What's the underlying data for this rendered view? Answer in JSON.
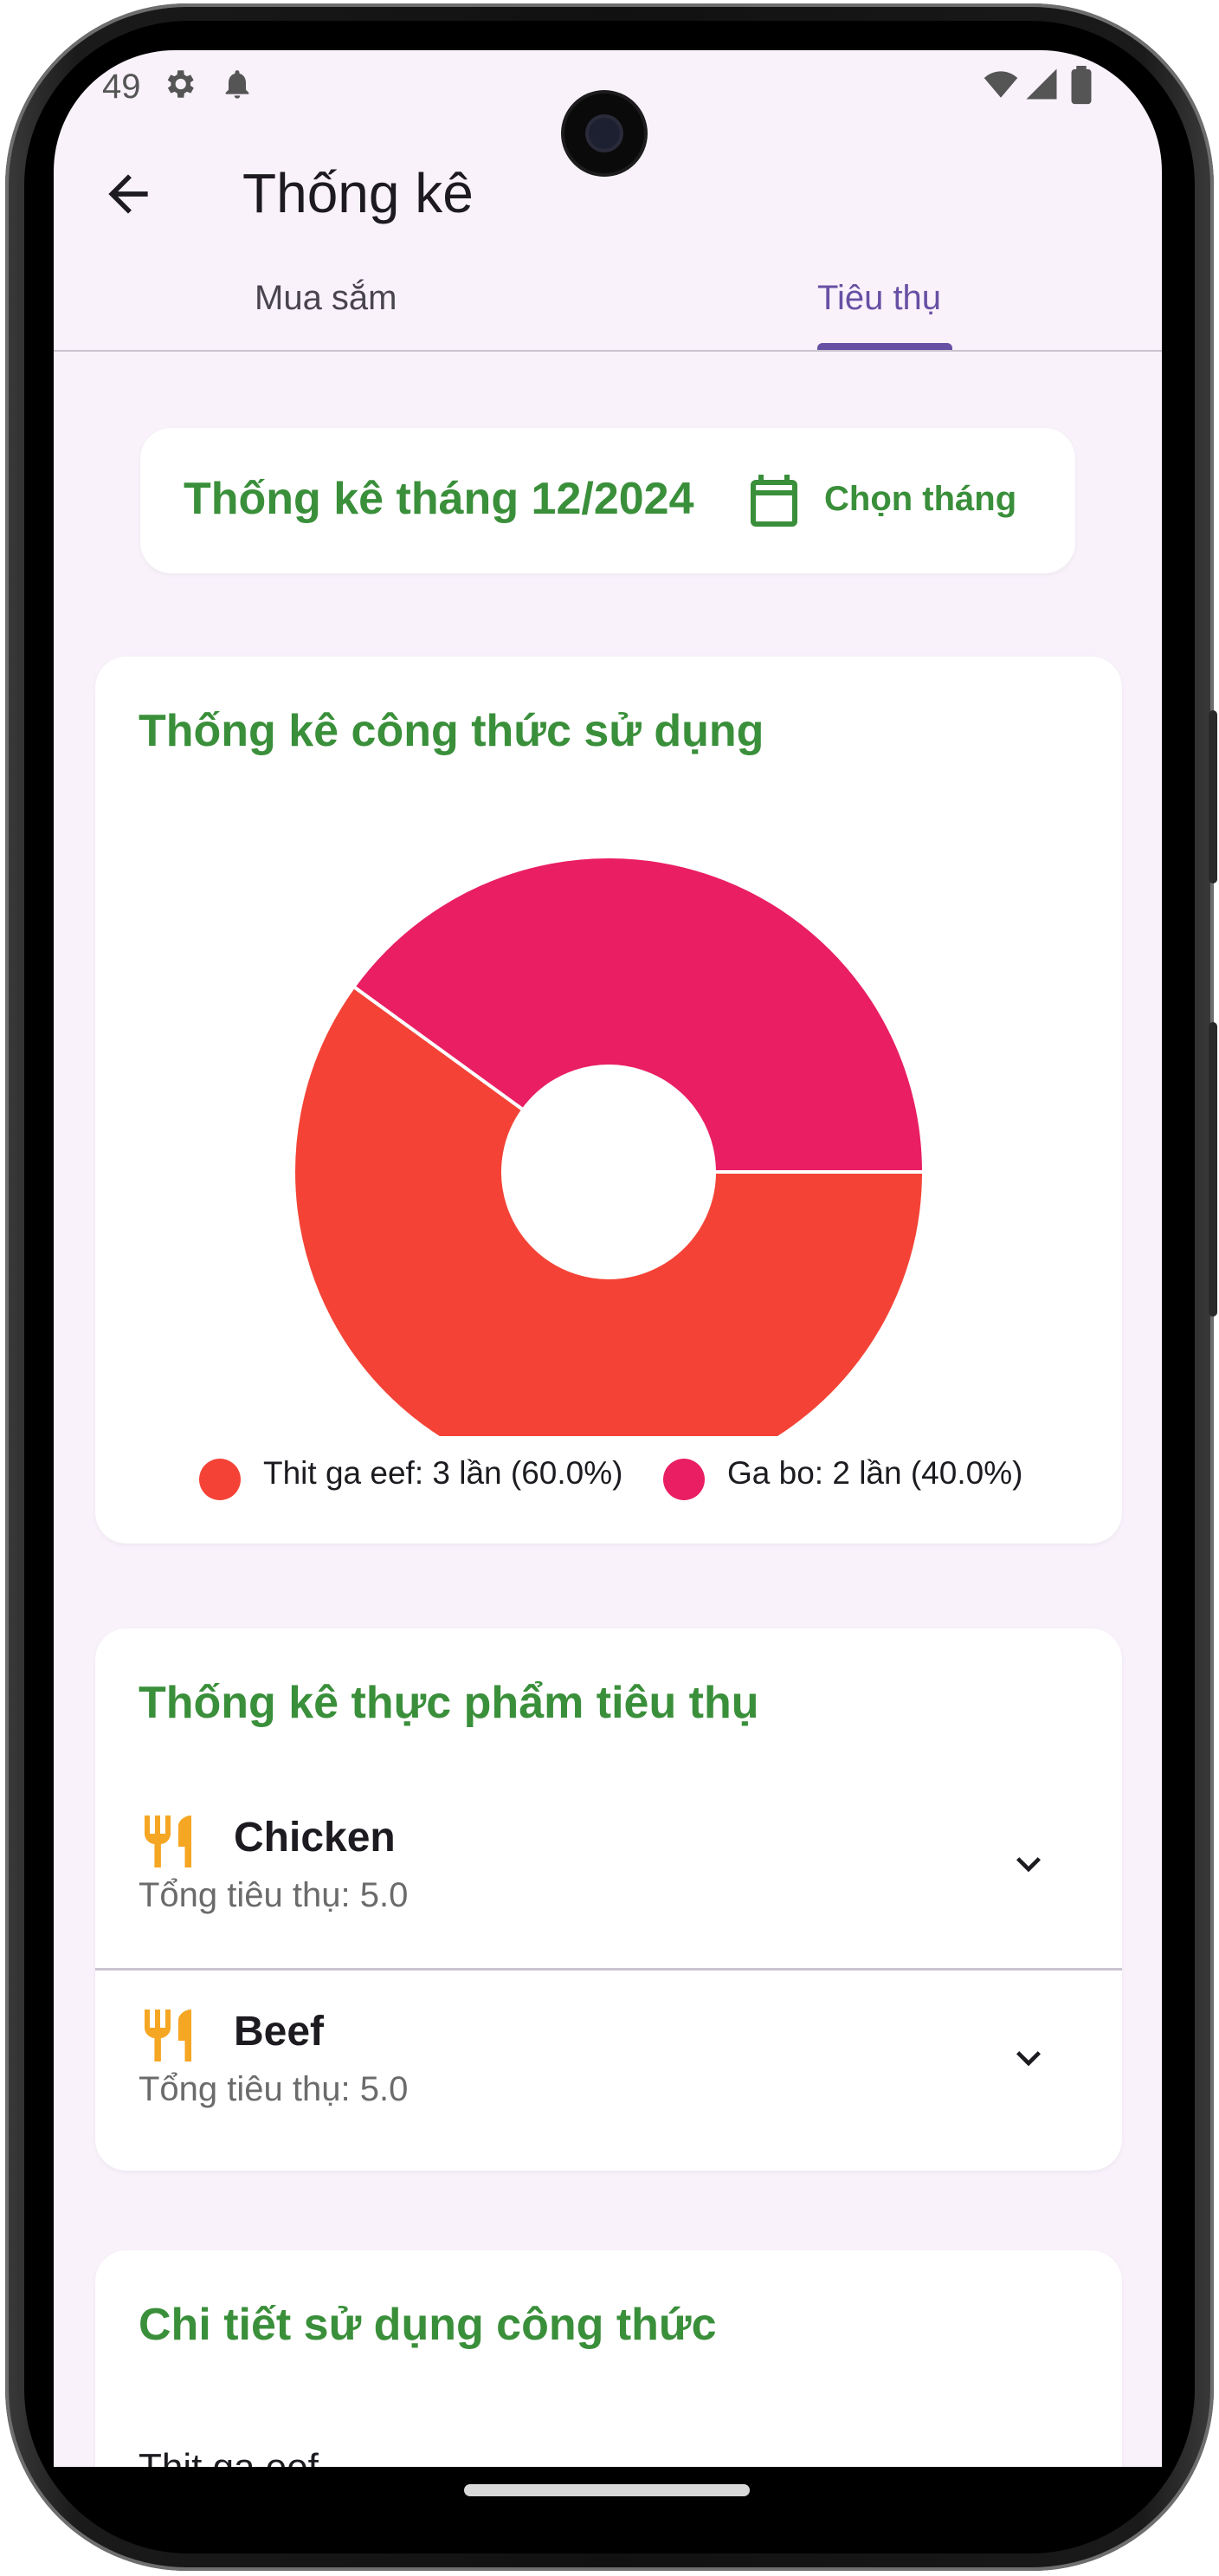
{
  "status_bar": {
    "time": "49"
  },
  "app_bar": {
    "title": "Thống kê"
  },
  "tabs": [
    {
      "label": "Mua sắm",
      "active": false
    },
    {
      "label": "Tiêu thụ",
      "active": true
    }
  ],
  "month_card": {
    "title": "Thống kê tháng 12/2024",
    "button_label": "Chọn tháng"
  },
  "recipe_chart_card": {
    "title": "Thống kê công thức sử dụng"
  },
  "chart_data": {
    "type": "pie",
    "donut": true,
    "categories": [
      "Thit ga eef",
      "Ga bo"
    ],
    "values": [
      3,
      2
    ],
    "percentages": [
      60.0,
      40.0
    ],
    "colors": [
      "#f44336",
      "#e91e63"
    ],
    "legend": [
      "Thit ga eef: 3 lần (60.0%)",
      "Ga bo: 2 lần (40.0%)"
    ],
    "legend_position": "bottom"
  },
  "food_card": {
    "title": "Thống kê thực phẩm tiêu thụ",
    "items": [
      {
        "name": "Chicken",
        "total": "Tổng tiêu thụ: 5.0"
      },
      {
        "name": "Beef",
        "total": "Tổng tiêu thụ: 5.0"
      }
    ]
  },
  "detail_card": {
    "title": "Chi tiết sử dụng công thức",
    "items": [
      "Thit ga eef"
    ]
  },
  "colors": {
    "accent_green": "#3a8f3a",
    "tab_purple": "#6750a4",
    "food_icon": "#f5a623",
    "background": "#f9f2fb"
  }
}
